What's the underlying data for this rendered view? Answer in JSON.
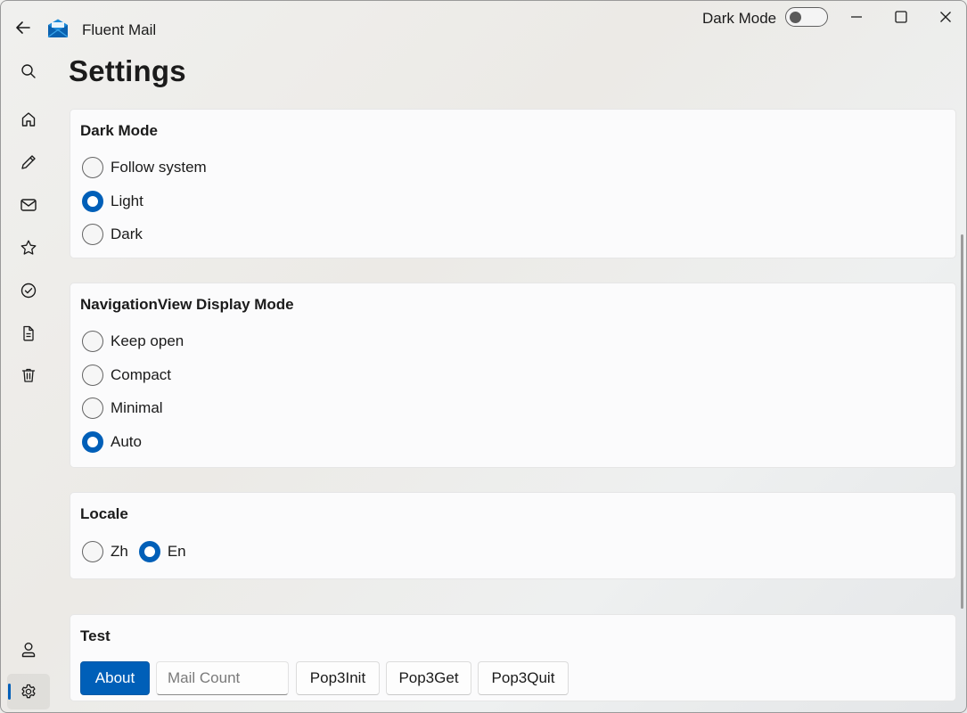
{
  "app": {
    "title": "Fluent Mail"
  },
  "titlebar": {
    "dark_mode_label": "Dark Mode",
    "dark_mode_on": false
  },
  "sidebar": {
    "items": [
      {
        "name": "search",
        "icon": "search-icon"
      },
      {
        "name": "home",
        "icon": "home-icon"
      },
      {
        "name": "compose",
        "icon": "pencil-icon"
      },
      {
        "name": "mail",
        "icon": "mail-icon"
      },
      {
        "name": "starred",
        "icon": "star-icon"
      },
      {
        "name": "done",
        "icon": "check-circle-icon"
      },
      {
        "name": "drafts",
        "icon": "document-icon"
      },
      {
        "name": "trash",
        "icon": "trash-icon"
      },
      {
        "name": "account",
        "icon": "person-icon"
      },
      {
        "name": "settings",
        "icon": "gear-icon",
        "selected": true
      }
    ]
  },
  "page": {
    "title": "Settings"
  },
  "dark_mode": {
    "title": "Dark Mode",
    "options": [
      "Follow system",
      "Light",
      "Dark"
    ],
    "selected": "Light"
  },
  "nav_display_mode": {
    "title": "NavigationView Display Mode",
    "options": [
      "Keep open",
      "Compact",
      "Minimal",
      "Auto"
    ],
    "selected": "Auto"
  },
  "locale": {
    "title": "Locale",
    "options": [
      "Zh",
      "En"
    ],
    "selected": "En"
  },
  "test": {
    "title": "Test",
    "about_label": "About",
    "mail_count_placeholder": "Mail Count",
    "mail_count_value": "",
    "pop3init_label": "Pop3Init",
    "pop3get_label": "Pop3Get",
    "pop3quit_label": "Pop3Quit"
  },
  "colors": {
    "accent": "#005fb8"
  }
}
